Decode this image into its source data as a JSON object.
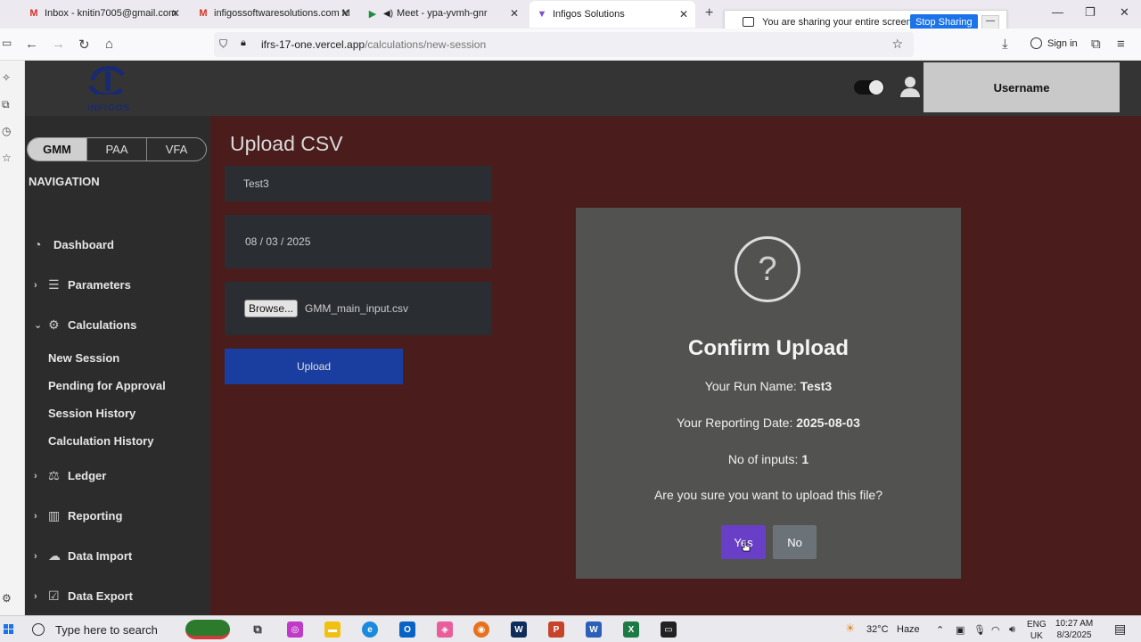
{
  "browser": {
    "tabs": [
      {
        "label": "Inbox - knitin7005@gmail.com",
        "icon": "gmail-icon"
      },
      {
        "label": "infigossoftwaresolutions.com M",
        "icon": "gmail-icon"
      },
      {
        "label": "Meet - ypa-yvmh-gnr",
        "icon": "meet-icon"
      },
      {
        "label": "Infigos Solutions",
        "icon": "infigos-icon"
      }
    ],
    "share_text": "You are sharing your entire screen.",
    "stop_sharing": "Stop Sharing",
    "url_host": "ifrs-17-one.vercel.app",
    "url_path": "/calculations/new-session",
    "signin": "Sign in"
  },
  "app": {
    "logo_text": "INFIGOS",
    "username": "Username",
    "segments": [
      "GMM",
      "PAA",
      "VFA"
    ],
    "active_segment": "GMM",
    "nav_heading": "NAVIGATION",
    "nav": {
      "dashboard": "Dashboard",
      "parameters": "Parameters",
      "calculations": "Calculations",
      "ledger": "Ledger",
      "reporting": "Reporting",
      "data_import": "Data Import",
      "data_export": "Data Export"
    },
    "calc_sub": {
      "new_session": "New Session",
      "pending": "Pending for Approval",
      "session_history": "Session History",
      "calc_history": "Calculation History"
    }
  },
  "form": {
    "title": "Upload CSV",
    "run_name": "Test3",
    "date": "08 / 03 / 2025",
    "browse": "Browse...",
    "file_name": "GMM_main_input.csv",
    "upload": "Upload"
  },
  "modal": {
    "icon": "?",
    "title": "Confirm Upload",
    "run_label": "Your Run Name:",
    "run_value": "Test3",
    "date_label": "Your Reporting Date:",
    "date_value": "2025-08-03",
    "inputs_label": "No of inputs:",
    "inputs_value": "1",
    "question": "Are you sure you want to upload this file?",
    "yes": "Yes",
    "no": "No"
  },
  "taskbar": {
    "search_placeholder": "Type here to search",
    "weather_temp": "32°C",
    "weather_desc": "Haze",
    "lang": "ENG",
    "region": "UK",
    "time": "10:27 AM",
    "date": "8/3/2025"
  },
  "colors": {
    "main_bg": "#4b1c1c",
    "modal_bg": "#525250",
    "yes": "#6a3fc7",
    "no": "#6c7378",
    "upload": "#1a3da0"
  }
}
